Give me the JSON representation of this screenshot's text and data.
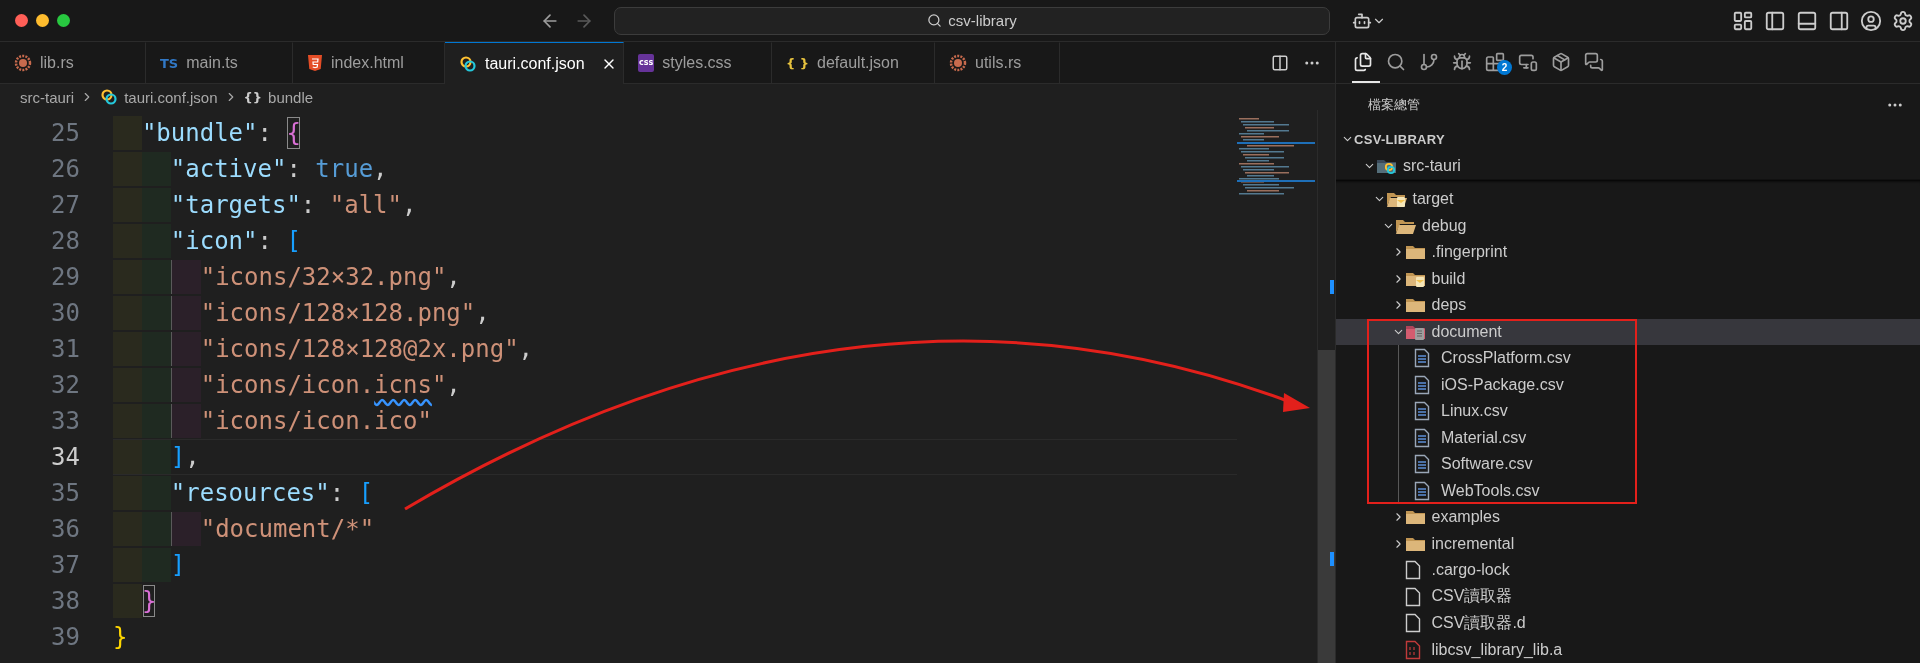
{
  "title_bar": {
    "search": "csv-library"
  },
  "tabs": [
    {
      "label": "lib.rs",
      "kind": "rust",
      "selected": false
    },
    {
      "label": "main.ts",
      "kind": "ts",
      "icon_text": "TS",
      "selected": false
    },
    {
      "label": "index.html",
      "kind": "html",
      "selected": false
    },
    {
      "label": "tauri.conf.json",
      "kind": "tauri",
      "selected": true
    },
    {
      "label": "styles.css",
      "kind": "css",
      "icon_text": "css",
      "selected": false
    },
    {
      "label": "default.json",
      "kind": "json",
      "icon_text": "{ }",
      "selected": false
    },
    {
      "label": "utils.rs",
      "kind": "rust",
      "selected": false
    }
  ],
  "breadcrumb": [
    {
      "label": "src-tauri",
      "kind": "folder"
    },
    {
      "label": "tauri.conf.json",
      "kind": "tauri"
    },
    {
      "label": "bundle",
      "kind": "object",
      "icon_text": "{}"
    }
  ],
  "code": [
    {
      "number": "25",
      "current": false,
      "tokens": [
        {
          "kind": "key",
          "text": "  \"bundle\""
        },
        {
          "kind": "punct",
          "text": ": "
        },
        {
          "kind": "brace-pink",
          "text": "{",
          "matched": true
        }
      ]
    },
    {
      "number": "26",
      "current": false,
      "tokens": [
        {
          "kind": "key",
          "text": "    \"active\""
        },
        {
          "kind": "punct",
          "text": ": "
        },
        {
          "kind": "bool",
          "text": "true"
        },
        {
          "kind": "punct",
          "text": ","
        }
      ]
    },
    {
      "number": "27",
      "current": false,
      "tokens": [
        {
          "kind": "key",
          "text": "    \"targets\""
        },
        {
          "kind": "punct",
          "text": ": "
        },
        {
          "kind": "string",
          "text": "\"all\""
        },
        {
          "kind": "punct",
          "text": ","
        }
      ]
    },
    {
      "number": "28",
      "current": false,
      "tokens": [
        {
          "kind": "key",
          "text": "    \"icon\""
        },
        {
          "kind": "punct",
          "text": ": "
        },
        {
          "kind": "brace-blue",
          "text": "[",
          "matched": false
        }
      ]
    },
    {
      "number": "29",
      "current": false,
      "tokens": [
        {
          "kind": "string",
          "text": "      \"icons/32×32.png\""
        },
        {
          "kind": "punct",
          "text": ","
        }
      ]
    },
    {
      "number": "30",
      "current": false,
      "tokens": [
        {
          "kind": "string",
          "text": "      \"icons/128×128.png\""
        },
        {
          "kind": "punct",
          "text": ","
        }
      ]
    },
    {
      "number": "31",
      "current": false,
      "tokens": [
        {
          "kind": "string",
          "text": "      \"icons/128×128@2x.png\""
        },
        {
          "kind": "punct",
          "text": ","
        }
      ]
    },
    {
      "number": "32",
      "current": false,
      "tokens": [
        {
          "kind": "string",
          "text": "      \"icons/icon.",
          "warning": false
        },
        {
          "kind": "string",
          "text": "icns",
          "warning": true
        },
        {
          "kind": "string",
          "text": "\"",
          "warning": false
        },
        {
          "kind": "punct",
          "text": ","
        }
      ]
    },
    {
      "number": "33",
      "current": false,
      "tokens": [
        {
          "kind": "string",
          "text": "      \"icons/icon.ico\""
        }
      ]
    },
    {
      "number": "34",
      "current": true,
      "tokens": [
        {
          "kind": "brace-blue",
          "text": "    ]",
          "matched": false
        },
        {
          "kind": "punct",
          "text": ","
        }
      ]
    },
    {
      "number": "35",
      "current": false,
      "tokens": [
        {
          "kind": "key",
          "text": "    \"resources\""
        },
        {
          "kind": "punct",
          "text": ": "
        },
        {
          "kind": "brace-blue",
          "text": "[",
          "matched": false
        }
      ]
    },
    {
      "number": "36",
      "current": false,
      "tokens": [
        {
          "kind": "string",
          "text": "      \"document/*\""
        }
      ]
    },
    {
      "number": "37",
      "current": false,
      "tokens": [
        {
          "kind": "brace-blue",
          "text": "    ]",
          "matched": false
        }
      ]
    },
    {
      "number": "38",
      "current": false,
      "tokens": [
        {
          "kind": "brace-pink",
          "text": "  }",
          "matched": true
        }
      ]
    },
    {
      "number": "39",
      "current": false,
      "tokens": [
        {
          "kind": "brace-gold",
          "text": "}",
          "matched": false
        }
      ]
    }
  ],
  "activity_bar": [
    {
      "kind": "explorer",
      "selected": true
    },
    {
      "kind": "search",
      "selected": false
    },
    {
      "kind": "source-control",
      "selected": false
    },
    {
      "kind": "run-debug",
      "selected": false
    },
    {
      "kind": "extensions",
      "badge": "2",
      "selected": false
    },
    {
      "kind": "remote",
      "selected": false
    },
    {
      "kind": "containers",
      "selected": false
    },
    {
      "kind": "chat",
      "selected": false
    }
  ],
  "explorer": {
    "title": "檔案總管",
    "root": {
      "label": "CSV-LIBRARY",
      "expanded": true
    },
    "items": [
      {
        "label": "src-tauri",
        "kind": "folder-tauri",
        "expanded": true,
        "selected": false,
        "children": [
          {
            "label": "target",
            "kind": "folder-special",
            "expanded": true,
            "selected": false,
            "children": [
              {
                "label": "debug",
                "kind": "folder",
                "expanded": true,
                "selected": false,
                "children": [
                  {
                    "label": ".fingerprint",
                    "kind": "folder",
                    "expanded": false,
                    "selected": false,
                    "highlighted": false
                  },
                  {
                    "label": "build",
                    "kind": "folder-special",
                    "expanded": false,
                    "selected": false,
                    "highlighted": false
                  },
                  {
                    "label": "deps",
                    "kind": "folder",
                    "expanded": false,
                    "selected": false,
                    "highlighted": false
                  },
                  {
                    "label": "document",
                    "kind": "folder-doc",
                    "expanded": true,
                    "selected": true,
                    "highlighted": true,
                    "children": [
                      {
                        "label": "CrossPlatform.csv",
                        "kind": "csv",
                        "selected": false
                      },
                      {
                        "label": "iOS-Package.csv",
                        "kind": "csv",
                        "selected": false
                      },
                      {
                        "label": "Linux.csv",
                        "kind": "csv",
                        "selected": false
                      },
                      {
                        "label": "Material.csv",
                        "kind": "csv",
                        "selected": false
                      },
                      {
                        "label": "Software.csv",
                        "kind": "csv",
                        "selected": false
                      },
                      {
                        "label": "WebTools.csv",
                        "kind": "csv",
                        "selected": false
                      }
                    ]
                  },
                  {
                    "label": "examples",
                    "kind": "folder",
                    "expanded": false,
                    "selected": false,
                    "highlighted": false
                  },
                  {
                    "label": "incremental",
                    "kind": "folder",
                    "expanded": false,
                    "selected": false,
                    "highlighted": false
                  },
                  {
                    "label": ".cargo-lock",
                    "kind": "file",
                    "selected": false,
                    "highlighted": false
                  },
                  {
                    "label": "CSV讀取器",
                    "kind": "file",
                    "selected": false,
                    "highlighted": false
                  },
                  {
                    "label": "CSV讀取器.d",
                    "kind": "file",
                    "selected": false,
                    "highlighted": false
                  },
                  {
                    "label": "libcsv_library_lib.a",
                    "kind": "binary",
                    "selected": false,
                    "highlighted": false
                  }
                ]
              }
            ]
          }
        ]
      }
    ]
  }
}
